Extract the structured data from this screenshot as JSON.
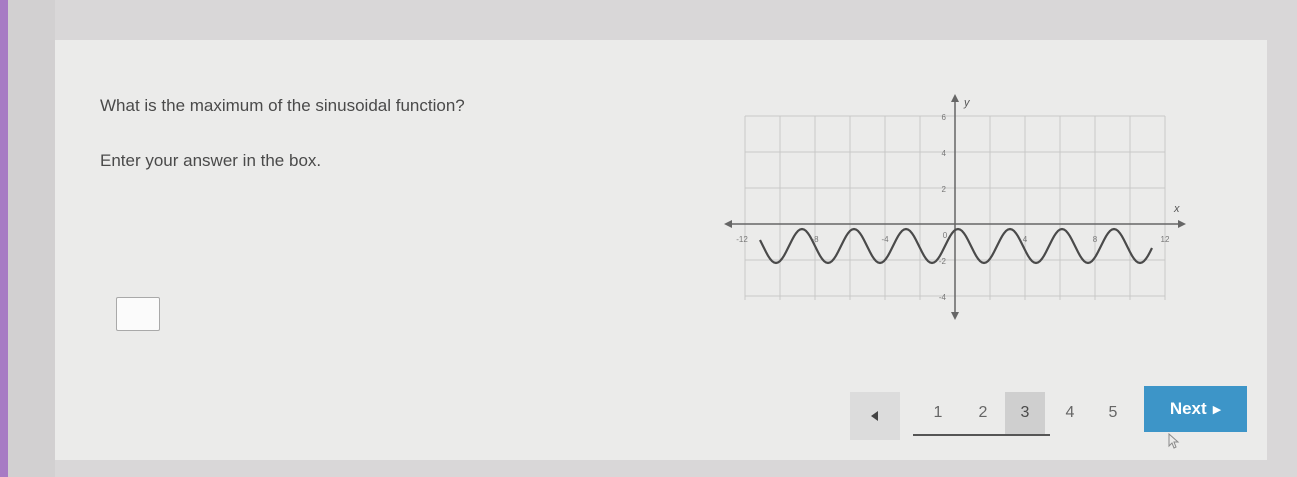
{
  "question": {
    "prompt": "What is the maximum of the sinusoidal function?",
    "instruction": "Enter your answer in the box.",
    "answer_value": ""
  },
  "graph": {
    "y_axis_label": "y",
    "x_axis_label": "x",
    "y_ticks": [
      "6",
      "4",
      "2",
      "-2",
      "-4"
    ],
    "x_ticks": [
      "-12",
      "-8",
      "-4",
      "0",
      "4",
      "8",
      "12"
    ],
    "curve_color": "#4a4a4a",
    "grid_color": "#c8c8c8"
  },
  "pagination": {
    "prev_icon": "triangle-left-icon",
    "pages": [
      "1",
      "2",
      "3",
      "4",
      "5"
    ],
    "current_page": "3",
    "next_label": "Next",
    "next_icon": "triangle-right-icon"
  },
  "colors": {
    "accent_left": "#a77bc4",
    "next_button": "#3d95c8"
  }
}
